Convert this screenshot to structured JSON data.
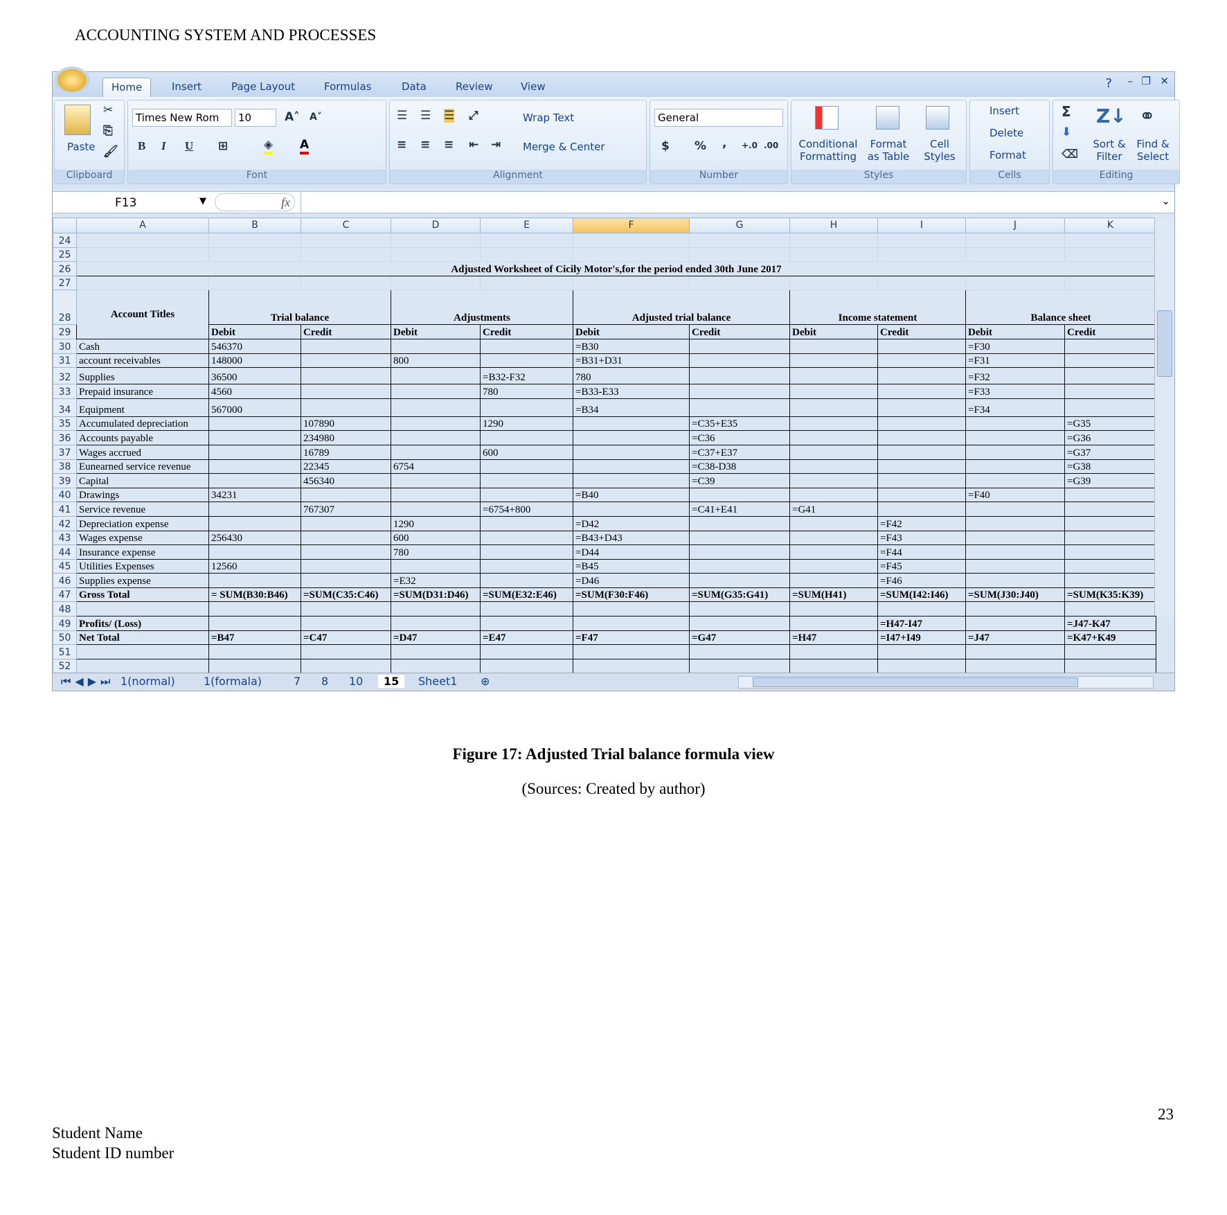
{
  "doc": {
    "header": "ACCOUNTING SYSTEM AND PROCESSES",
    "caption": "Figure 17: Adjusted Trial balance formula view",
    "source": "(Sources: Created by author)",
    "page_number": "23",
    "student_name": "Student Name",
    "student_id": "Student ID number"
  },
  "ribbon": {
    "tabs": [
      "Home",
      "Insert",
      "Page Layout",
      "Formulas",
      "Data",
      "Review",
      "View"
    ],
    "active_tab": "Home",
    "groups": [
      "Clipboard",
      "Font",
      "Alignment",
      "Number",
      "Styles",
      "Cells",
      "Editing"
    ],
    "paste": "Paste",
    "font_name": "Times New Rom",
    "font_size": "10",
    "wrap_text": "Wrap Text",
    "merge_center": "Merge & Center",
    "number_format": "General",
    "currency": "$",
    "percent": "%",
    "comma": ",",
    "conditional_formatting": [
      "Conditional",
      "Formatting"
    ],
    "format_as_table": [
      "Format",
      "as Table"
    ],
    "cell_styles": [
      "Cell",
      "Styles"
    ],
    "insert": "Insert",
    "delete": "Delete",
    "format": "Format",
    "sum": "Σ",
    "sort_filter": [
      "Sort &",
      "Filter"
    ],
    "find_select": [
      "Find &",
      "Select"
    ],
    "bold": "B",
    "italic": "I",
    "underline": "U"
  },
  "formula_bar": {
    "name_box": "F13",
    "fx": "fx",
    "formula": ""
  },
  "sheet": {
    "columns": [
      "A",
      "B",
      "C",
      "D",
      "E",
      "F",
      "G",
      "H",
      "I",
      "J",
      "K"
    ],
    "selected_column": "F",
    "title": "Adjusted Worksheet of Cicily Motor's,for the period ended 30th June 2017",
    "group_headers": {
      "account_titles": "Account Titles",
      "trial_balance": "Trial balance",
      "adjustments": "Adjustments",
      "adjusted_trial_balance": "Adjusted trial balance",
      "income_statement": "Income statement",
      "balance_sheet": "Balance sheet"
    },
    "sub_headers": [
      "Debit",
      "Credit",
      "Debit",
      "Credit",
      "Debit",
      "Credit",
      "Debit",
      "Credit",
      "Debit",
      "Credit"
    ],
    "rows": [
      {
        "n": "30",
        "c": [
          "Cash",
          "546370",
          "",
          "",
          "",
          "=B30",
          "",
          "",
          "",
          "=F30",
          ""
        ]
      },
      {
        "n": "31",
        "c": [
          "account receivables",
          "148000",
          "",
          "800",
          "",
          "=B31+D31",
          "",
          "",
          "",
          "=F31",
          ""
        ]
      },
      {
        "n": "32",
        "c": [
          "Supplies",
          "36500",
          "",
          "",
          "=B32-F32",
          "780",
          "",
          "",
          "",
          "=F32",
          ""
        ]
      },
      {
        "n": "33",
        "c": [
          "Prepaid insurance",
          "4560",
          "",
          "",
          "780",
          "=B33-E33",
          "",
          "",
          "",
          "=F33",
          ""
        ]
      },
      {
        "n": "34",
        "c": [
          "Equipment",
          "567000",
          "",
          "",
          "",
          "=B34",
          "",
          "",
          "",
          "=F34",
          ""
        ]
      },
      {
        "n": "35",
        "c": [
          "Accumulated depreciation",
          "",
          "107890",
          "",
          "1290",
          "",
          "=C35+E35",
          "",
          "",
          "",
          "=G35"
        ]
      },
      {
        "n": "36",
        "c": [
          "Accounts payable",
          "",
          "234980",
          "",
          "",
          "",
          "=C36",
          "",
          "",
          "",
          "=G36"
        ]
      },
      {
        "n": "37",
        "c": [
          "Wages accrued",
          "",
          "16789",
          "",
          "600",
          "",
          "=C37+E37",
          "",
          "",
          "",
          "=G37"
        ]
      },
      {
        "n": "38",
        "c": [
          "Eunearned service revenue",
          "",
          "22345",
          "6754",
          "",
          "",
          "=C38-D38",
          "",
          "",
          "",
          "=G38"
        ]
      },
      {
        "n": "39",
        "c": [
          "Capital",
          "",
          "456340",
          "",
          "",
          "",
          "=C39",
          "",
          "",
          "",
          "=G39"
        ]
      },
      {
        "n": "40",
        "c": [
          "Drawings",
          "34231",
          "",
          "",
          "",
          "=B40",
          "",
          "",
          "",
          "=F40",
          ""
        ]
      },
      {
        "n": "41",
        "c": [
          "Service revenue",
          "",
          "767307",
          "",
          "=6754+800",
          "",
          "=C41+E41",
          "=G41",
          "",
          "",
          ""
        ]
      },
      {
        "n": "42",
        "c": [
          "Depreciation expense",
          "",
          "",
          "1290",
          "",
          "=D42",
          "",
          "",
          "=F42",
          "",
          ""
        ]
      },
      {
        "n": "43",
        "c": [
          "Wages expense",
          "256430",
          "",
          "600",
          "",
          "=B43+D43",
          "",
          "",
          "=F43",
          "",
          ""
        ]
      },
      {
        "n": "44",
        "c": [
          "Insurance expense",
          "",
          "",
          "780",
          "",
          "=D44",
          "",
          "",
          "=F44",
          "",
          ""
        ]
      },
      {
        "n": "45",
        "c": [
          "Utilities Expenses",
          "12560",
          "",
          "",
          "",
          "=B45",
          "",
          "",
          "=F45",
          "",
          ""
        ]
      },
      {
        "n": "46",
        "c": [
          "Supplies expense",
          "",
          "",
          "=E32",
          "",
          "=D46",
          "",
          "",
          "=F46",
          "",
          ""
        ]
      },
      {
        "n": "47",
        "bold": true,
        "c": [
          "Gross Total",
          "= SUM(B30:B46)",
          "=SUM(C35:C46)",
          "=SUM(D31:D46)",
          "=SUM(E32:E46)",
          "=SUM(F30:F46)",
          "=SUM(G35:G41)",
          "=SUM(H41)",
          "=SUM(I42:I46)",
          "=SUM(J30:J40)",
          "=SUM(K35:K39)"
        ]
      },
      {
        "n": "48",
        "c": [
          "",
          "",
          "",
          "",
          "",
          "",
          "",
          "",
          "",
          "",
          ""
        ]
      },
      {
        "n": "49",
        "bold": true,
        "c": [
          "Profits/ (Loss)",
          "",
          "",
          "",
          "",
          "",
          "",
          "",
          "=H47-I47",
          "",
          "=J47-K47"
        ]
      },
      {
        "n": "50",
        "bold": true,
        "c": [
          "Net Total",
          "=B47",
          "=C47",
          "=D47",
          "=E47",
          "=F47",
          "=G47",
          "=H47",
          "=I47+I49",
          "=J47",
          "=K47+K49"
        ]
      },
      {
        "n": "51",
        "c": [
          "",
          "",
          "",
          "",
          "",
          "",
          "",
          "",
          "",
          "",
          ""
        ]
      },
      {
        "n": "52",
        "c": [
          "",
          "",
          "",
          "",
          "",
          "",
          "",
          "",
          "",
          "",
          ""
        ]
      }
    ]
  },
  "sheet_tabs": [
    "1(normal)",
    "1(formala)",
    "7",
    "8",
    "10",
    "15",
    "Sheet1"
  ],
  "active_sheet": "15"
}
